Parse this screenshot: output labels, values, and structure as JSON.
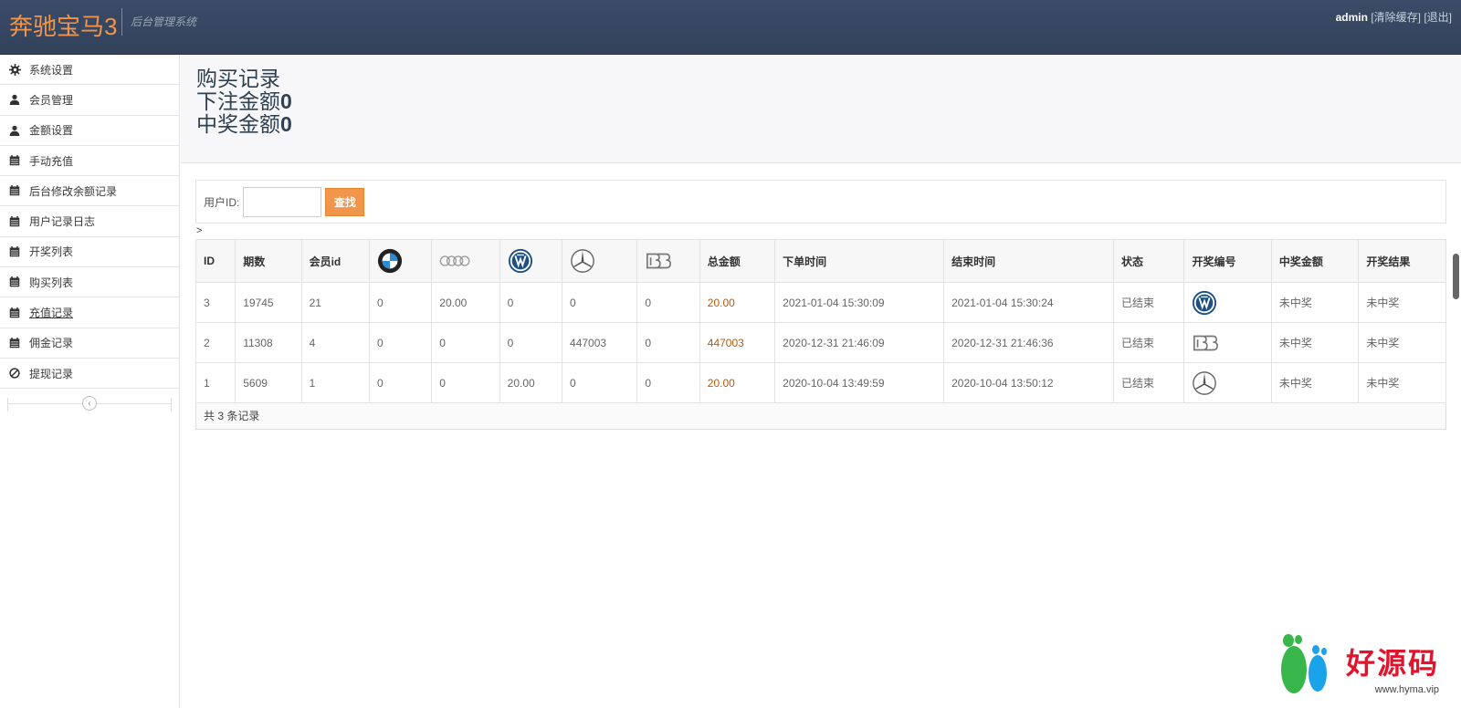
{
  "header": {
    "brand": "奔驰宝马3",
    "subtitle": "后台管理系统",
    "user": "admin",
    "clear_cache": "[清除缓存]",
    "logout": "[退出]"
  },
  "sidebar": {
    "items": [
      {
        "label": "系统设置",
        "icon": "gear-icon"
      },
      {
        "label": "会员管理",
        "icon": "user-icon"
      },
      {
        "label": "金额设置",
        "icon": "user-icon"
      },
      {
        "label": "手动充值",
        "icon": "calendar-icon"
      },
      {
        "label": "后台修改余额记录",
        "icon": "calendar-icon"
      },
      {
        "label": "用户记录日志",
        "icon": "calendar-icon"
      },
      {
        "label": "开奖列表",
        "icon": "calendar-icon"
      },
      {
        "label": "购买列表",
        "icon": "calendar-icon"
      },
      {
        "label": "充值记录",
        "icon": "calendar-icon"
      },
      {
        "label": "佣金记录",
        "icon": "calendar-icon"
      },
      {
        "label": "提现记录",
        "icon": "ban-icon"
      }
    ],
    "active_index": 8,
    "collapse_icon": "chevron-left-icon"
  },
  "page": {
    "title": "购买记录",
    "bet_label": "下注金额",
    "bet_value": "0",
    "win_label": "中奖金额",
    "win_value": "0"
  },
  "search": {
    "label": "用户ID:",
    "value": "",
    "placeholder": "",
    "button": "查找"
  },
  "breadcrumb": ">",
  "table": {
    "columns": [
      "ID",
      "期数",
      "会员id",
      "bmw-logo",
      "audi-logo",
      "vw-logo",
      "mercedes-logo",
      "bugatti-logo",
      "总金额",
      "下单时间",
      "结束时间",
      "状态",
      "开奖编号",
      "中奖金额",
      "开奖结果"
    ],
    "rows": [
      {
        "id": "3",
        "period": "19745",
        "member": "21",
        "bmw": "0",
        "audi": "20.00",
        "vw": "0",
        "benz": "0",
        "bugatti": "0",
        "total": "20.00",
        "order_time": "2021-01-04 15:30:09",
        "end_time": "2021-01-04 15:30:24",
        "status": "已结束",
        "draw": "vw-logo",
        "prize": "未中奖",
        "result": "未中奖"
      },
      {
        "id": "2",
        "period": "11308",
        "member": "4",
        "bmw": "0",
        "audi": "0",
        "vw": "0",
        "benz": "447003",
        "bugatti": "0",
        "total": "447003",
        "order_time": "2020-12-31 21:46:09",
        "end_time": "2020-12-31 21:46:36",
        "status": "已结束",
        "draw": "bugatti-logo",
        "prize": "未中奖",
        "result": "未中奖"
      },
      {
        "id": "1",
        "period": "5609",
        "member": "1",
        "bmw": "0",
        "audi": "0",
        "vw": "20.00",
        "benz": "0",
        "bugatti": "0",
        "total": "20.00",
        "order_time": "2020-10-04 13:49:59",
        "end_time": "2020-10-04 13:50:12",
        "status": "已结束",
        "draw": "mercedes-logo",
        "prize": "未中奖",
        "result": "未中奖"
      }
    ],
    "footer": "共 3 条记录"
  },
  "watermark": {
    "text": "好源码",
    "url": "www.hyma.vip"
  },
  "colors": {
    "header_bg": "#3b4b67",
    "brand": "#f0954a",
    "button": "#f0954a",
    "amount": "#b35a13"
  }
}
